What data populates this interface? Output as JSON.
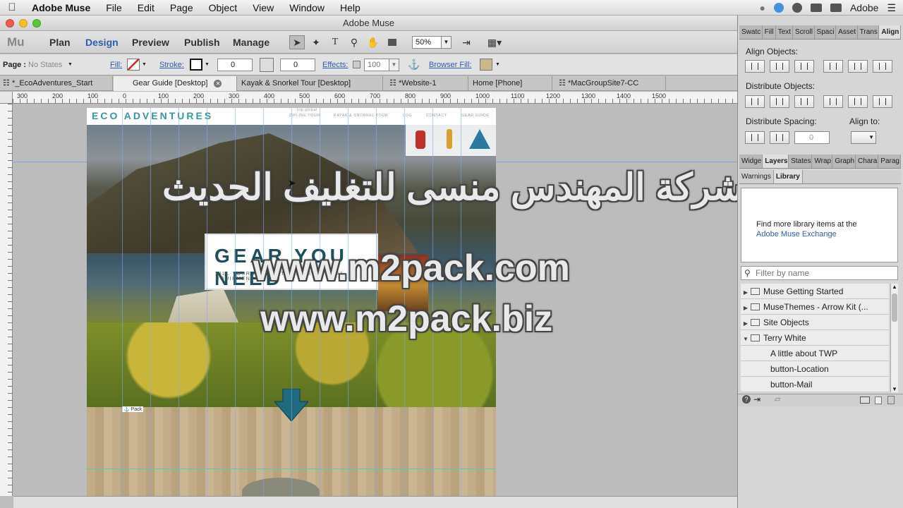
{
  "menubar": {
    "app_name": "Adobe Muse",
    "items": [
      "File",
      "Edit",
      "Page",
      "Object",
      "View",
      "Window",
      "Help"
    ],
    "right_label": "Adobe"
  },
  "window": {
    "title": "Adobe Muse"
  },
  "workspace": {
    "logo": "Mu",
    "modes": [
      "Plan",
      "Design",
      "Preview",
      "Publish",
      "Manage"
    ],
    "active_mode": "Design",
    "zoom": "50%"
  },
  "control": {
    "page_label": "Page :",
    "states": "No States",
    "fill": "Fill:",
    "stroke": "Stroke:",
    "stroke_value": "0",
    "padding_value": "0",
    "effects": "Effects:",
    "effects_value": "100",
    "browser_fill": "Browser Fill:"
  },
  "tabs": [
    {
      "label": "*_EcoAdventures_Start",
      "active": false
    },
    {
      "label": "Gear Guide [Desktop]",
      "active": true
    },
    {
      "label": "Kayak & Snorkel Tour [Desktop]",
      "active": false
    },
    {
      "label": "*Website-1",
      "active": false
    },
    {
      "label": "Home [Phone]",
      "active": false
    },
    {
      "label": "*MacGroupSite7-CC",
      "active": false
    }
  ],
  "ruler": {
    "h_labels": [
      "300",
      "200",
      "100",
      "0",
      "100",
      "200",
      "300",
      "400",
      "500",
      "600",
      "700",
      "800",
      "900",
      "1000",
      "1100",
      "1200",
      "1300",
      "1400",
      "1500"
    ]
  },
  "site": {
    "logo": "ECO ADVENTURES",
    "nav": [
      "ZIPLINE TOUR",
      "KAYAK & SNORKEL TOUR",
      "LOG",
      "CONTACT",
      "GEAR GUIDE"
    ],
    "nav_sub": "top global",
    "headline": "GEAR YOU NEED",
    "subline": "FILL YOUR PACK WITH THE ESSENTIAL EQUIPMENT",
    "anchor_label": "Pack"
  },
  "watermark": {
    "arabic": "شركة المهندس منسى للتغليف الحديث",
    "line1": "www.m2pack.com",
    "line2": "www.m2pack.biz"
  },
  "panel": {
    "top_tabs": [
      "Swatc",
      "Fill",
      "Text",
      "Scroll",
      "Spaci",
      "Asset",
      "Trans",
      "Align"
    ],
    "align_objects": "Align Objects:",
    "distribute_objects": "Distribute Objects:",
    "distribute_spacing": "Distribute Spacing:",
    "align_to": "Align to:",
    "spacing_value": "0",
    "mid_tabs": [
      "Widge",
      "Layers",
      "States",
      "Wrap",
      "Graph",
      "Chara",
      "Parag"
    ],
    "lib_tabs": [
      "Warnings",
      "Library"
    ],
    "lib_message": "Find more library items at the",
    "lib_link": "Adobe Muse Exchange",
    "filter_placeholder": "Filter by name",
    "library_items": [
      {
        "label": "Muse Getting Started",
        "type": "folder"
      },
      {
        "label": "MuseThemes - Arrow Kit (...",
        "type": "folder"
      },
      {
        "label": "Site Objects",
        "type": "folder"
      },
      {
        "label": "Terry White",
        "type": "folder-open"
      },
      {
        "label": "A little about TWP",
        "type": "item"
      },
      {
        "label": "button-Location",
        "type": "item"
      },
      {
        "label": "button-Mail",
        "type": "item"
      }
    ]
  },
  "colors": {
    "accent": "#2a5db0",
    "teal": "#2e9a9e",
    "heading": "#1e4f5e"
  }
}
